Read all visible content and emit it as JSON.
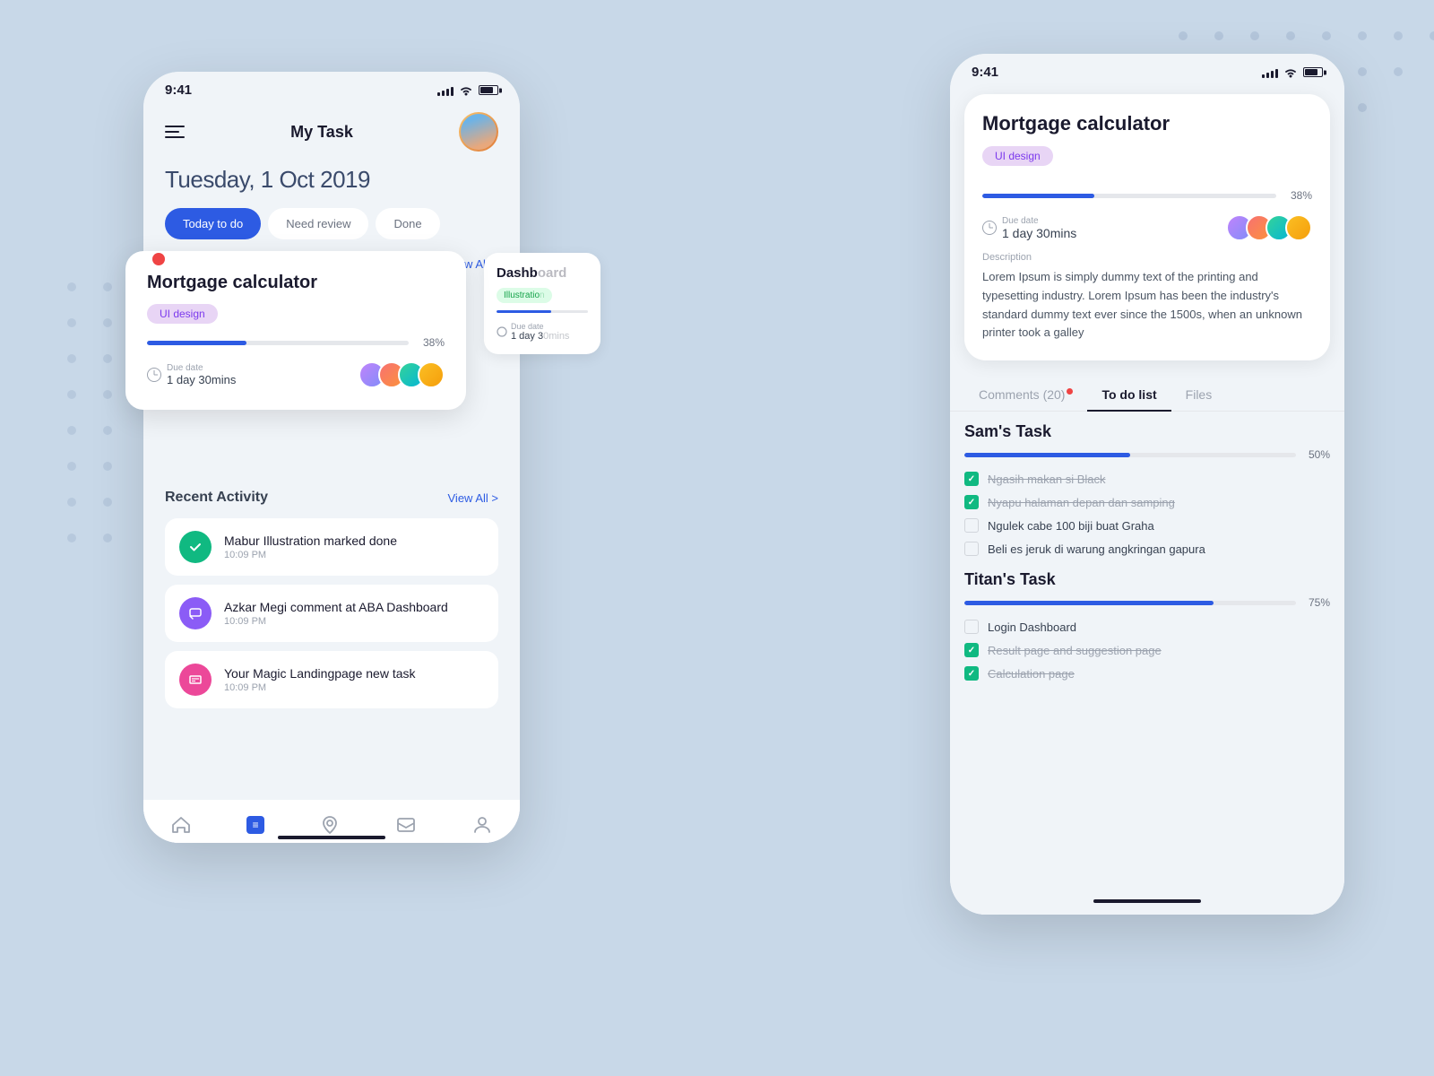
{
  "background": {
    "color": "#c8d8e8"
  },
  "phone1": {
    "statusBar": {
      "time": "9:41"
    },
    "header": {
      "title": "My Task"
    },
    "date": "Tuesday, 1 Oct 2019",
    "tabs": [
      {
        "label": "Today to do",
        "active": true
      },
      {
        "label": "Need review",
        "active": false
      },
      {
        "label": "Done",
        "active": false
      }
    ],
    "viewAllLabel": "View All >",
    "mortgageCard": {
      "title": "Mortgage calculator",
      "tag": "UI design",
      "progress": 38,
      "progressLabel": "38%",
      "dueLabel": "Due date",
      "dueValue": "1 day 30mins"
    },
    "recentActivity": {
      "title": "Recent Activity",
      "viewAll": "View All >",
      "items": [
        {
          "text": "Mabur Illustration marked done",
          "time": "10:09 PM",
          "type": "check"
        },
        {
          "text": "Azkar Megi comment at ABA Dashboard",
          "time": "10:09 PM",
          "type": "comment"
        },
        {
          "text": "Your Magic Landingpage new task",
          "time": "10:09 PM",
          "type": "task"
        }
      ]
    },
    "bottomNav": [
      {
        "icon": "home",
        "label": ""
      },
      {
        "icon": "task",
        "label": ""
      },
      {
        "icon": "location",
        "label": ""
      },
      {
        "icon": "inbox",
        "label": ""
      },
      {
        "icon": "person",
        "label": ""
      }
    ]
  },
  "phone2": {
    "statusBar": {
      "time": "9:41"
    },
    "mortgageDetail": {
      "title": "Mortgage calculator",
      "tag": "UI design",
      "progress": 38,
      "progressLabel": "38%",
      "dueLabel": "Due date",
      "dueValue": "1 day 30mins",
      "descriptionLabel": "Description",
      "descriptionText": "Lorem Ipsum is simply dummy text of the printing and typesetting industry. Lorem Ipsum has been the industry's standard dummy text ever since the 1500s, when an unknown printer took a galley"
    },
    "tabs": [
      {
        "label": "Comments (20)",
        "active": false,
        "hasDot": true
      },
      {
        "label": "To do list",
        "active": true
      },
      {
        "label": "Files",
        "active": false
      }
    ],
    "samsTask": {
      "title": "Sam's Task",
      "progress": 50,
      "progressLabel": "50%",
      "items": [
        {
          "text": "Ngasih makan si Black",
          "done": true
        },
        {
          "text": "Nyapu halaman depan dan samping",
          "done": true
        },
        {
          "text": "Ngulek cabe 100 biji buat Graha",
          "done": false
        },
        {
          "text": "Beli es jeruk di warung angkringan gapura",
          "done": false
        }
      ]
    },
    "titansTask": {
      "title": "Titan's Task",
      "progress": 75,
      "progressLabel": "75%",
      "items": [
        {
          "text": "Login Dashboard",
          "done": false
        },
        {
          "text": "Result page and suggestion page",
          "done": true
        },
        {
          "text": "Calculation page",
          "done": true
        }
      ]
    }
  }
}
